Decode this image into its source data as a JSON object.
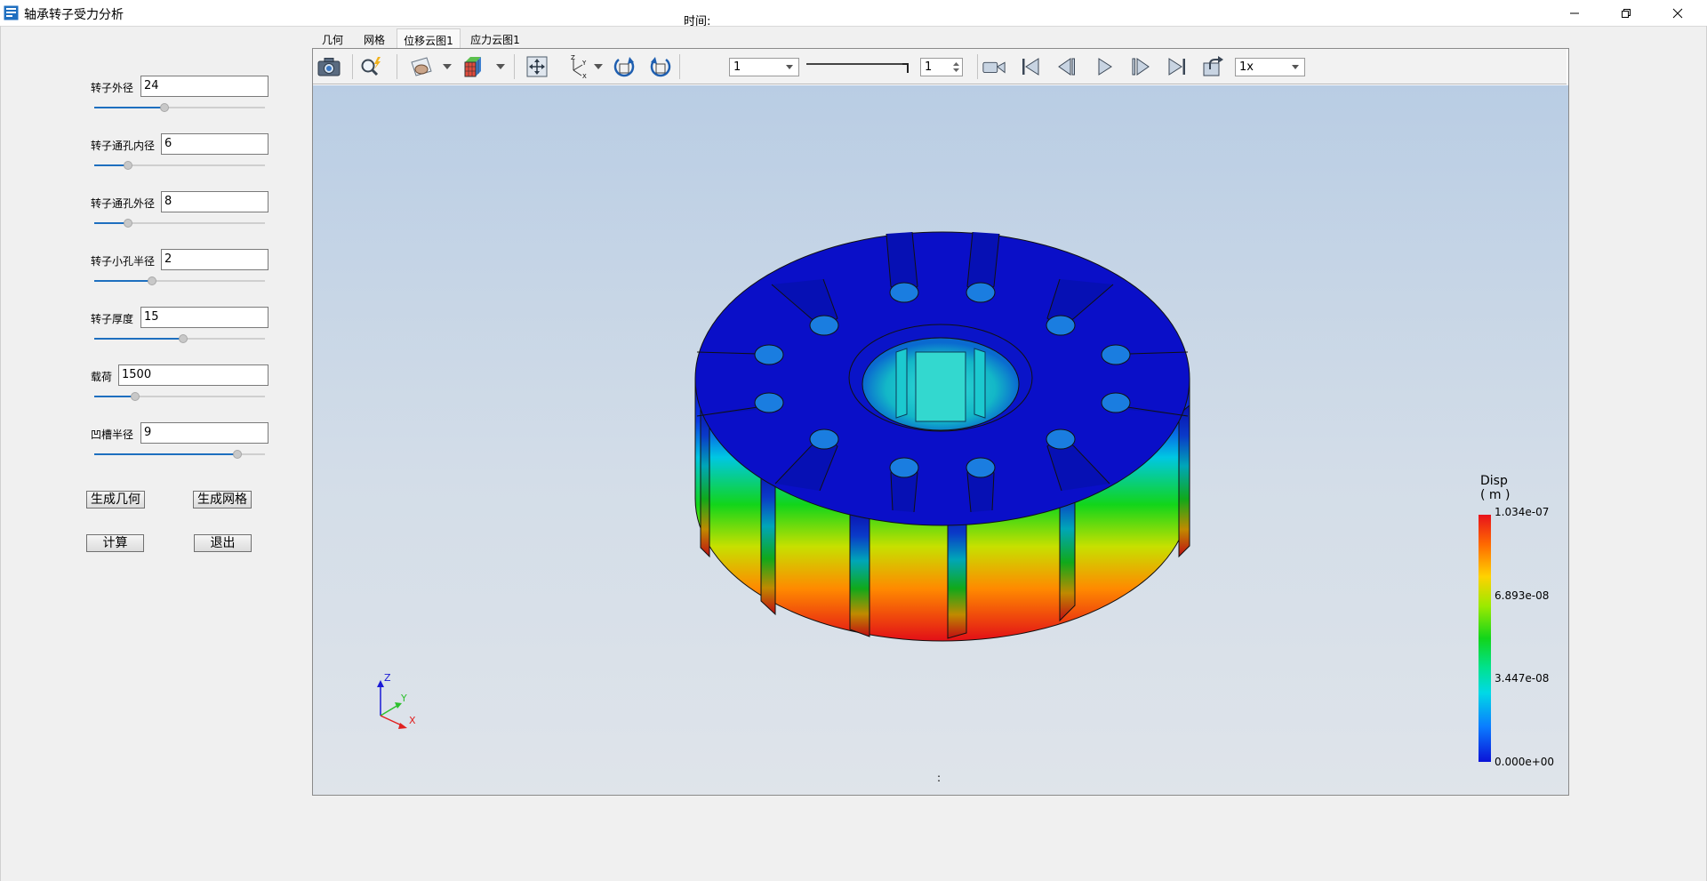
{
  "window": {
    "title": "轴承转子受力分析",
    "min_icon": "minimize-icon",
    "max_icon": "restore-icon",
    "close_icon": "close-icon"
  },
  "params": [
    {
      "label": "转子外径",
      "value": "24",
      "slider_fraction": 0.41
    },
    {
      "label": "转子通孔内径",
      "value": "6",
      "slider_fraction": 0.2
    },
    {
      "label": "转子通孔外径",
      "value": "8",
      "slider_fraction": 0.2
    },
    {
      "label": "转子小孔半径",
      "value": "2",
      "slider_fraction": 0.34
    },
    {
      "label": "转子厚度",
      "value": "15",
      "slider_fraction": 0.52
    },
    {
      "label": "载荷",
      "value": "1500",
      "slider_fraction": 0.24
    },
    {
      "label": "凹槽半径",
      "value": "9",
      "slider_fraction": 0.84
    }
  ],
  "buttons": {
    "gen_geometry": "生成几何",
    "gen_mesh": "生成网格",
    "compute": "计算",
    "exit": "退出"
  },
  "tabs": [
    {
      "label": "几何",
      "active": false
    },
    {
      "label": "网格",
      "active": false
    },
    {
      "label": "位移云图1",
      "active": true
    },
    {
      "label": "应力云图1",
      "active": false
    }
  ],
  "toolbar": {
    "icons": [
      "camera-icon",
      "zoom-icon",
      "clip-plane-icon",
      "color-cube-icon",
      "fit-view-icon",
      "axes-icon",
      "rotate-left-icon",
      "rotate-right-icon"
    ],
    "time_label": "时间:",
    "time_value": "1",
    "frame_value": "1",
    "speed_value": "1x",
    "playback_icons": [
      "record-video-icon",
      "first-frame-icon",
      "prev-frame-icon",
      "play-icon",
      "next-frame-icon",
      "last-frame-icon",
      "export-icon"
    ]
  },
  "legend": {
    "title": "Disp",
    "unit": "( m )",
    "max": "1.034e-07",
    "ticks": [
      "1.034e-07",
      "6.893e-08",
      "3.447e-08",
      "0.000e+00"
    ],
    "colors": [
      "#e8121c",
      "#ffd200",
      "#12d51a",
      "#00d9e6",
      "#0a12d8"
    ]
  },
  "axes_triad": {
    "x": "X",
    "y": "Y",
    "z": "Z"
  },
  "viewport_footer": ":"
}
